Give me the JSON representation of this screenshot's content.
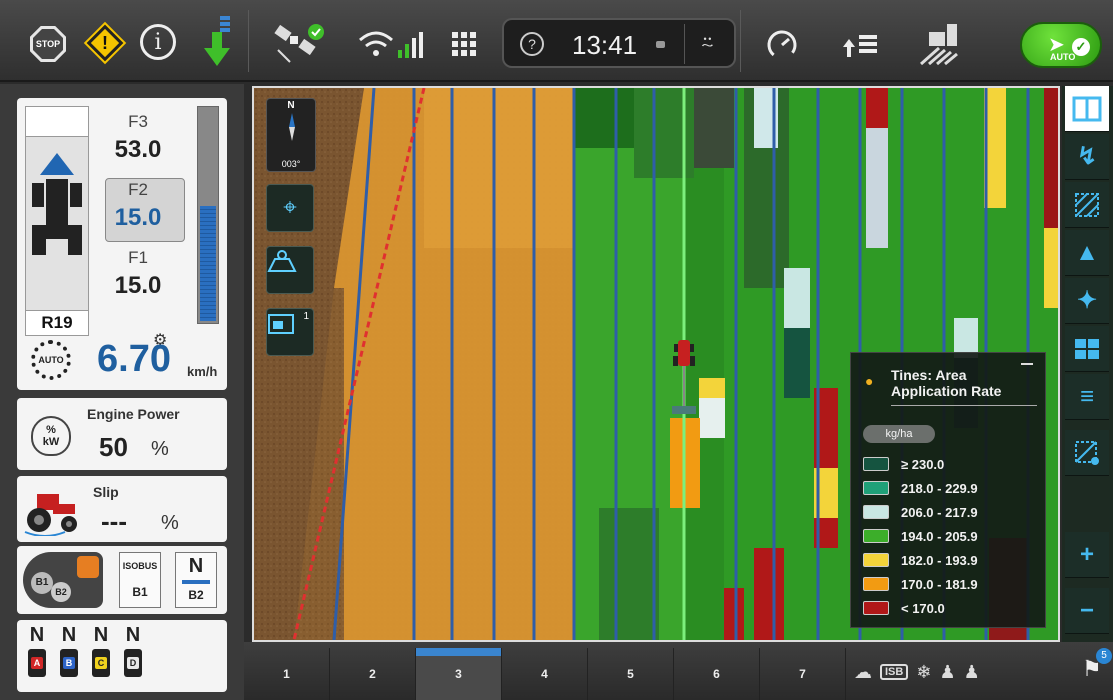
{
  "topbar": {
    "stop_label": "STOP",
    "clock_time": "13:41",
    "auto_label": "AUTO",
    "help_symbol": "?",
    "icons": [
      "stop-icon",
      "warning-icon",
      "info-icon",
      "download-icon",
      "satellite-icon",
      "wifi-signal-icon",
      "grid-menu-icon",
      "help-icon",
      "camera-icon",
      "user-icon",
      "gauge-icon",
      "lift-icon",
      "field-icon",
      "auto-steer-icon"
    ]
  },
  "tractor_panel": {
    "gears": [
      {
        "label": "F3",
        "value": "53.0"
      },
      {
        "label": "F2",
        "value": "15.0"
      },
      {
        "label": "F1",
        "value": "15.0"
      }
    ],
    "reverse_gear": "R19",
    "speed_value": "6.70",
    "speed_unit": "km/h",
    "auto_label": "AUTO",
    "slider_level_percent": 55
  },
  "engine_power": {
    "title": "Engine Power",
    "value": "50",
    "unit": "%",
    "icon_text": "%\nkW"
  },
  "slip": {
    "title": "Slip",
    "value": "---",
    "unit": "%"
  },
  "hitch": {
    "badges": [
      "B1",
      "B2"
    ],
    "isobus_label": "ISOBUS",
    "box1_value": "B1",
    "box2_top": "N",
    "box2_value": "B2"
  },
  "valves": {
    "states": [
      "N",
      "N",
      "N",
      "N"
    ],
    "letters": [
      "A",
      "B",
      "C",
      "D"
    ],
    "colors": [
      "#d12727",
      "#2d64c8",
      "#f0d21e",
      "#e8e8e8"
    ]
  },
  "map": {
    "compass_letter": "N",
    "heading": "003°",
    "tool_icons": [
      "target-icon",
      "map-layer-icon",
      "implement-display-icon"
    ],
    "implement_badge": "1"
  },
  "legend": {
    "title_line1": "Tines: Area",
    "title_line2": "Application Rate",
    "unit": "kg/ha",
    "entries": [
      {
        "label": "≥ 230.0",
        "color": "#155440"
      },
      {
        "label": "218.0 - 229.9",
        "color": "#1fa078"
      },
      {
        "label": "206.0 - 217.9",
        "color": "#c9e7e3"
      },
      {
        "label": "194.0 - 205.9",
        "color": "#3cae2a"
      },
      {
        "label": "182.0 - 193.9",
        "color": "#f3d43a"
      },
      {
        "label": "170.0 - 181.9",
        "color": "#f29b12"
      },
      {
        "label": "< 170.0",
        "color": "#b01818"
      }
    ]
  },
  "right_toolbar": {
    "icons": [
      "split-view-icon",
      "guidance-line-icon",
      "boundary-icon",
      "cone-icon",
      "center-icon",
      "layout-icon",
      "layers-icon",
      "field-edit-icon",
      "zoom-in-icon",
      "zoom-out-icon"
    ]
  },
  "bottom_tabs": [
    "1",
    "2",
    "3",
    "4",
    "5",
    "6",
    "7"
  ],
  "active_tab": "3",
  "notifications": {
    "count": "5",
    "isb_label": "ISB"
  }
}
